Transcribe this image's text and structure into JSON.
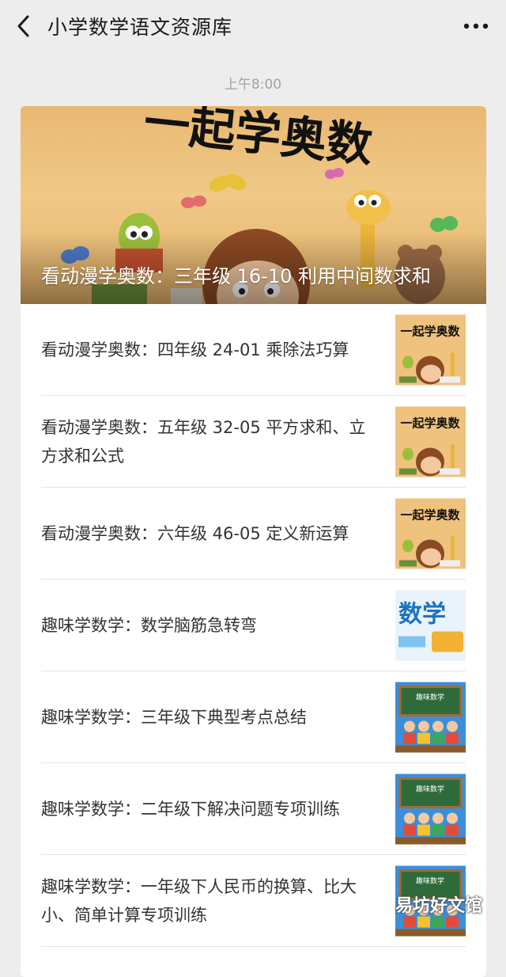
{
  "header": {
    "title": "小学数学语文资源库",
    "back_icon": "chevron-left-icon",
    "more_icon": "more-dots-icon"
  },
  "timestamp": "上午8:00",
  "hero": {
    "title": "看动漫学奥数：三年级 16-10 利用中间数求和",
    "image_text": "一起学奥数"
  },
  "articles": [
    {
      "title": "看动漫学奥数：四年级 24-01 乘除法巧算",
      "thumb": "cartoon"
    },
    {
      "title": "看动漫学奥数：五年级 32-05 平方求和、立方求和公式",
      "thumb": "cartoon"
    },
    {
      "title": "看动漫学奥数：六年级 46-05 定义新运算",
      "thumb": "cartoon"
    },
    {
      "title": "趣味学数学：数学脑筋急转弯",
      "thumb": "math-fun",
      "thumb_text": "数学"
    },
    {
      "title": "趣味学数学：三年级下典型考点总结",
      "thumb": "classroom",
      "thumb_text": "趣味数学"
    },
    {
      "title": "趣味学数学：二年级下解决问题专项训练",
      "thumb": "classroom",
      "thumb_text": "趣味数学"
    },
    {
      "title": "趣味学数学：一年级下人民币的换算、比大小、简单计算专项训练",
      "thumb": "classroom",
      "thumb_text": "趣味数学"
    }
  ],
  "watermark": "易坊好文馆"
}
